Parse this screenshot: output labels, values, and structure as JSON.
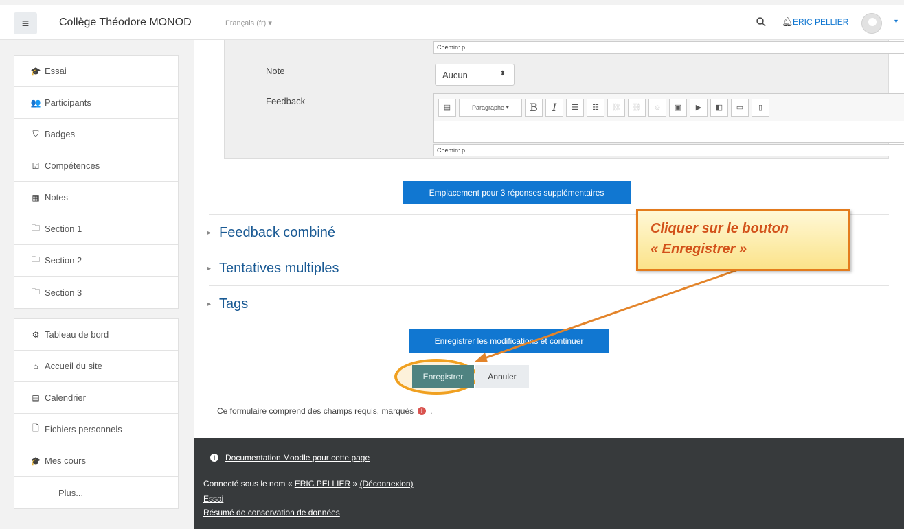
{
  "header": {
    "site_name": "Collège Théodore MONOD",
    "language": "Français (fr)",
    "user_name": "ERIC PELLIER",
    "icons": [
      "hamburger-icon",
      "search-icon",
      "bell-icon",
      "avatar",
      "caret-down-icon"
    ]
  },
  "sidebar": {
    "course_items": [
      {
        "label": "Essai",
        "icon": "graduation-cap-icon",
        "glyph": "🎓"
      },
      {
        "label": "Participants",
        "icon": "users-icon",
        "glyph": "👥"
      },
      {
        "label": "Badges",
        "icon": "shield-icon",
        "glyph": "⛉"
      },
      {
        "label": "Compétences",
        "icon": "checkbox-icon",
        "glyph": "☑"
      },
      {
        "label": "Notes",
        "icon": "table-icon",
        "glyph": "▦"
      },
      {
        "label": "Section 1",
        "icon": "folder-icon",
        "glyph": "🗀"
      },
      {
        "label": "Section 2",
        "icon": "folder-icon",
        "glyph": "🗀"
      },
      {
        "label": "Section 3",
        "icon": "folder-icon",
        "glyph": "🗀"
      }
    ],
    "site_items": [
      {
        "label": "Tableau de bord",
        "icon": "dashboard-icon",
        "glyph": "⚙"
      },
      {
        "label": "Accueil du site",
        "icon": "home-icon",
        "glyph": "⌂"
      },
      {
        "label": "Calendrier",
        "icon": "calendar-icon",
        "glyph": "▤"
      },
      {
        "label": "Fichiers personnels",
        "icon": "file-icon",
        "glyph": "🗋"
      },
      {
        "label": "Mes cours",
        "icon": "graduation-cap-icon",
        "glyph": "🎓"
      }
    ],
    "more": "Plus..."
  },
  "form": {
    "path_label": "Chemin: p",
    "note_label": "Note",
    "note_value": "Aucun",
    "feedback_label": "Feedback",
    "paragraph_label": "Paragraphe",
    "add_answers_button": "Emplacement pour 3 réponses supplémentaires",
    "sections": [
      "Feedback combiné",
      "Tentatives multiples",
      "Tags"
    ],
    "save_continue_button": "Enregistrer les modifications et continuer",
    "save_button": "Enregistrer",
    "cancel_button": "Annuler",
    "required_note": "Ce formulaire comprend des champs requis, marqués",
    "required_suffix": "."
  },
  "annotation": {
    "line1": "Cliquer sur le bouton",
    "line2": "« Enregistrer »",
    "border_color": "#e37c1d",
    "text_color": "#d2511a"
  },
  "footer": {
    "doc_link": "Documentation Moodle pour cette page",
    "logged_prefix": "Connecté sous le nom « ",
    "logged_user": "ERIC PELLIER",
    "logged_mid": " » ",
    "logout": "(Déconnexion)",
    "course_link": "Essai",
    "summary_link": "Résumé de conservation de données"
  },
  "colors": {
    "primary": "#1177d1",
    "save_button": "#4f8381",
    "footer_bg": "#373a3c",
    "heading_link": "#1a5a94"
  }
}
